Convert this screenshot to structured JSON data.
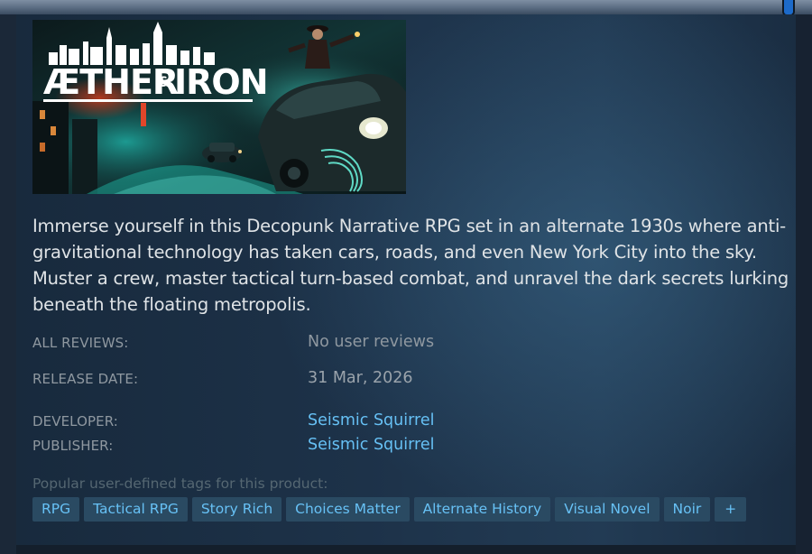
{
  "capsule": {
    "logo_text_left": "ÆTHER",
    "logo_text_amp": "&",
    "logo_text_right": "IRON"
  },
  "description": "Immerse yourself in this Decopunk Narrative RPG set in an alternate 1930s where anti-gravitational technology has taken cars, roads, and even New York City into the sky. Muster a crew, master tactical turn-based combat, and unravel the dark secrets lurking beneath the floating metropolis.",
  "details": {
    "all_reviews_label": "ALL REVIEWS:",
    "all_reviews_value": "No user reviews",
    "release_date_label": "RELEASE DATE:",
    "release_date_value": "31 Mar, 2026",
    "developer_label": "DEVELOPER:",
    "developer_value": "Seismic Squirrel",
    "publisher_label": "PUBLISHER:",
    "publisher_value": "Seismic Squirrel"
  },
  "tags": {
    "heading": "Popular user-defined tags for this product:",
    "items": [
      "RPG",
      "Tactical RPG",
      "Story Rich",
      "Choices Matter",
      "Alternate History",
      "Visual Novel",
      "Noir"
    ],
    "more_label": "+"
  },
  "colors": {
    "background": "#1b2838",
    "link": "#66c0f4",
    "tag_bg": "#2a4a62",
    "label": "#8f98a0",
    "scroll_accent": "#1c6ac9"
  }
}
